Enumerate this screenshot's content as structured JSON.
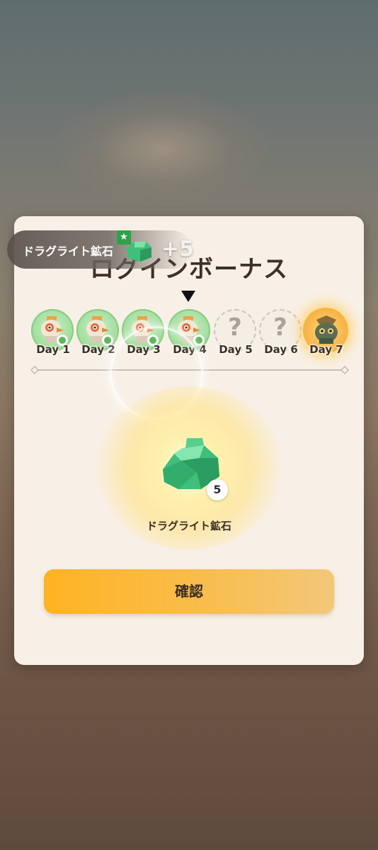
{
  "toast": {
    "item_name": "ドラグライト鉱石",
    "amount": "+5"
  },
  "modal": {
    "title": "ログインボーナス",
    "current_day": 4,
    "days": [
      {
        "label": "Day 1",
        "state": "claimed"
      },
      {
        "label": "Day 2",
        "state": "claimed"
      },
      {
        "label": "Day 3",
        "state": "claimed"
      },
      {
        "label": "Day 4",
        "state": "claimed"
      },
      {
        "label": "Day 5",
        "state": "locked",
        "mystery": "?"
      },
      {
        "label": "Day 6",
        "state": "locked",
        "mystery": "?"
      },
      {
        "label": "Day 7",
        "state": "special"
      }
    ],
    "reward": {
      "name": "ドラグライト鉱石",
      "count": "5"
    },
    "confirm_label": "確認"
  },
  "colors": {
    "claimed_green": "#9ddc9a",
    "gold": "#f7b64a",
    "button_orange": "#ffb322",
    "modal_bg": "#f8f0e6"
  }
}
